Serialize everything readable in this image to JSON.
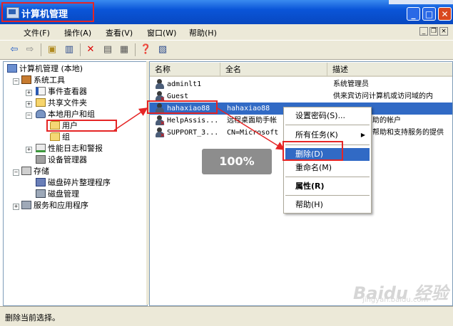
{
  "window": {
    "title": "计算机管理"
  },
  "menu": [
    "文件(F)",
    "操作(A)",
    "查看(V)",
    "窗口(W)",
    "帮助(H)"
  ],
  "mdi_controls": [
    "_",
    "❐",
    "×"
  ],
  "toolbar_icons": [
    "back-arrow-icon",
    "forward-arrow-icon",
    "up-folder-icon",
    "show-tree-icon",
    "delete-icon",
    "properties-icon",
    "export-icon",
    "help-icon",
    "show-pane-icon"
  ],
  "tree": {
    "root": "计算机管理 (本地)",
    "system_tools": "系统工具",
    "event_viewer": "事件查看器",
    "shared_folders": "共享文件夹",
    "local_users": "本地用户和组",
    "users": "用户",
    "groups": "组",
    "perf_logs": "性能日志和警报",
    "device_manager": "设备管理器",
    "storage": "存储",
    "defrag": "磁盘碎片整理程序",
    "disk_mgmt": "磁盘管理",
    "services": "服务和应用程序"
  },
  "list": {
    "columns": [
      "名称",
      "全名",
      "描述"
    ],
    "rows": [
      {
        "name": "adminlt1",
        "fullname": "",
        "desc": "系统管理员"
      },
      {
        "name": "Guest",
        "fullname": "",
        "desc": "供来宾访问计算机或访问域的内"
      },
      {
        "name": "hahaxiao88",
        "fullname": "hahaxiao88",
        "desc": ""
      },
      {
        "name": "HelpAssis...",
        "fullname": "远程桌面助手帐",
        "desc": "助的帐户"
      },
      {
        "name": "SUPPORT_3...",
        "fullname": "CN=Microsoft",
        "desc": "帮助和支持服务的提供"
      }
    ]
  },
  "context_menu": {
    "set_password": "设置密码(S)...",
    "all_tasks": "所有任务(K)",
    "delete": "删除(D)",
    "rename": "重命名(M)",
    "properties": "属性(R)",
    "help": "帮助(H)"
  },
  "progress_label": "100%",
  "status": "删除当前选择。",
  "watermark": {
    "brand": "Baidu 经验",
    "url": "jingyan.baidu.com"
  },
  "colors": {
    "title_blue": "#0a55d8",
    "selection": "#316ac5",
    "annotation_red": "#e52525",
    "chrome": "#ece9d8"
  }
}
